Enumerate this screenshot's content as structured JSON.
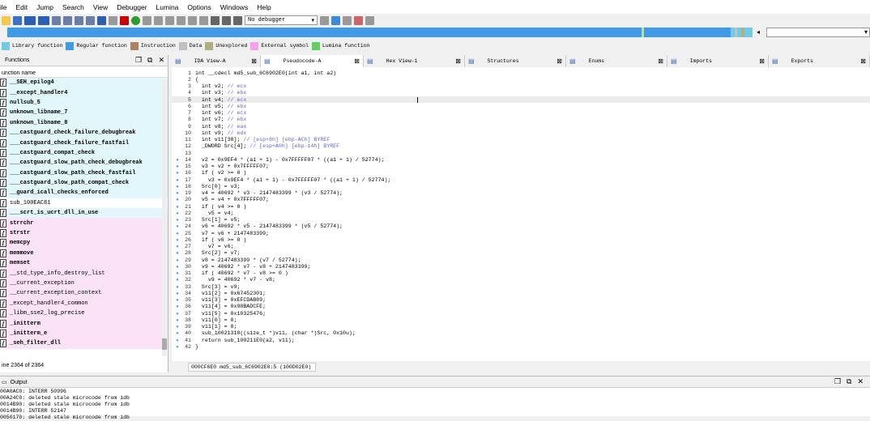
{
  "menubar": [
    "ile",
    "Edit",
    "Jump",
    "Search",
    "View",
    "Debugger",
    "Lumina",
    "Options",
    "Windows",
    "Help"
  ],
  "toolbar": {
    "debugger_label": "No debugger"
  },
  "legend": [
    {
      "label": "Library function",
      "color": "#70cbe6"
    },
    {
      "label": "Regular function",
      "color": "#3f9be6"
    },
    {
      "label": "Instruction",
      "color": "#b08060"
    },
    {
      "label": "Data",
      "color": "#c0c0c0"
    },
    {
      "label": "Unexplored",
      "color": "#b0ae7e"
    },
    {
      "label": "External symbol",
      "color": "#f7a0f0"
    },
    {
      "label": "Lumina function",
      "color": "#60d060"
    }
  ],
  "functions": {
    "title": "Functions",
    "column": "unction name",
    "status": "ine 2364 of 2364",
    "items": [
      {
        "name": "__SEH_epilog4",
        "style": "lib"
      },
      {
        "name": "__except_handler4",
        "style": "lib"
      },
      {
        "name": "nullsub_5",
        "style": "lib"
      },
      {
        "name": "unknown_libname_7",
        "style": "lib"
      },
      {
        "name": "unknown_libname_8",
        "style": "lib"
      },
      {
        "name": "___castguard_check_failure_debugbreak",
        "style": "lib"
      },
      {
        "name": "___castguard_check_failure_fastfail",
        "style": "lib"
      },
      {
        "name": "___castguard_compat_check",
        "style": "lib"
      },
      {
        "name": "___castguard_slow_path_check_debugbreak",
        "style": "lib"
      },
      {
        "name": "___castguard_slow_path_check_fastfail",
        "style": "lib"
      },
      {
        "name": "___castguard_slow_path_compat_check",
        "style": "lib"
      },
      {
        "name": "__guard_icall_checks_enforced",
        "style": "libb"
      },
      {
        "name": "sub_100EAC81",
        "style": "reg"
      },
      {
        "name": "___scrt_is_ucrt_dll_in_use",
        "style": "lib"
      },
      {
        "name": "strrchr",
        "style": "extb"
      },
      {
        "name": "strstr",
        "style": "extb"
      },
      {
        "name": "memcpy",
        "style": "extb"
      },
      {
        "name": "memmove",
        "style": "extb"
      },
      {
        "name": "memset",
        "style": "extb"
      },
      {
        "name": "__std_type_info_destroy_list",
        "style": "ext"
      },
      {
        "name": "__current_exception",
        "style": "ext"
      },
      {
        "name": "__current_exception_context",
        "style": "ext"
      },
      {
        "name": "_except_handler4_common",
        "style": "ext"
      },
      {
        "name": "_libm_sse2_log_precise",
        "style": "ext"
      },
      {
        "name": "_initterm",
        "style": "extb"
      },
      {
        "name": "_initterm_e",
        "style": "extb"
      },
      {
        "name": "_seh_filter_dll",
        "style": "extb"
      }
    ]
  },
  "tabs": [
    {
      "label": "IDA View-A",
      "width": 110
    },
    {
      "label": "Pseudocode-A",
      "width": 127,
      "active": true
    },
    {
      "label": "Hex View-1",
      "width": 125
    },
    {
      "label": "Structures",
      "width": 125
    },
    {
      "label": "Enums",
      "width": 125
    },
    {
      "label": "Imports",
      "width": 125
    },
    {
      "label": "Exports",
      "width": 125
    }
  ],
  "code": [
    {
      "n": "1",
      "t": "int __cdecl md5_sub_6C6902E0(int a1, int a2)",
      "c": ""
    },
    {
      "n": "2",
      "t": "{",
      "c": ""
    },
    {
      "n": "3",
      "t": "  int v2; ",
      "c": "// ecx"
    },
    {
      "n": "4",
      "t": "  int v3; ",
      "c": "// ebx"
    },
    {
      "n": "5",
      "t": "  int v4; ",
      "c": "// ecx"
    },
    {
      "n": "6",
      "t": "  int v5; ",
      "c": "// ebx"
    },
    {
      "n": "7",
      "t": "  int v6; ",
      "c": "// ecx"
    },
    {
      "n": "8",
      "t": "  int v7; ",
      "c": "// ebx"
    },
    {
      "n": "9",
      "t": "  int v8; ",
      "c": "// eax"
    },
    {
      "n": "10",
      "t": "  int v9; ",
      "c": "// edx"
    },
    {
      "n": "11",
      "t": "  int v11[38]; ",
      "c": "// [esp+8h] [ebp-ACh] BYREF"
    },
    {
      "n": "12",
      "t": "  _DWORD Src[4]; ",
      "c": "// [esp+A0h] [ebp-14h] BYREF"
    },
    {
      "n": "13",
      "t": "",
      "c": ""
    },
    {
      "n": "14",
      "t": "  v2 = 0x9EF4 * (a1 + 1) - 0x7FFFFF07 * ((a1 + 1) / 52774);",
      "c": "",
      "d": 1
    },
    {
      "n": "15",
      "t": "  v3 = v2 + 0x7FFFFF07;",
      "c": "",
      "d": 1
    },
    {
      "n": "16",
      "t": "  if ( v2 >= 0 )",
      "c": "",
      "d": 1
    },
    {
      "n": "17",
      "t": "    v3 = 0x9EF4 * (a1 + 1) - 0x7FFFFF07 * ((a1 + 1) / 52774);",
      "c": "",
      "d": 1
    },
    {
      "n": "18",
      "t": "  Src[0] = v3;",
      "c": "",
      "d": 1
    },
    {
      "n": "19",
      "t": "  v4 = 40692 * v3 - 2147483399 * (v3 / 52774);",
      "c": "",
      "d": 1
    },
    {
      "n": "20",
      "t": "  v5 = v4 + 0x7FFFFF07;",
      "c": "",
      "d": 1
    },
    {
      "n": "21",
      "t": "  if ( v4 >= 0 )",
      "c": "",
      "d": 1
    },
    {
      "n": "22",
      "t": "    v5 = v4;",
      "c": "",
      "d": 1
    },
    {
      "n": "23",
      "t": "  Src[1] = v5;",
      "c": "",
      "d": 1
    },
    {
      "n": "24",
      "t": "  v6 = 40692 * v5 - 2147483399 * (v5 / 52774);",
      "c": "",
      "d": 1
    },
    {
      "n": "25",
      "t": "  v7 = v6 + 2147483399;",
      "c": "",
      "d": 1
    },
    {
      "n": "26",
      "t": "  if ( v6 >= 0 )",
      "c": "",
      "d": 1
    },
    {
      "n": "27",
      "t": "    v7 = v6;",
      "c": "",
      "d": 1
    },
    {
      "n": "28",
      "t": "  Src[2] = v7;",
      "c": "",
      "d": 1
    },
    {
      "n": "29",
      "t": "  v8 = 2147483399 * (v7 / 52774);",
      "c": "",
      "d": 1
    },
    {
      "n": "30",
      "t": "  v9 = 40692 * v7 - v8 + 2147483399;",
      "c": "",
      "d": 1
    },
    {
      "n": "31",
      "t": "  if ( 40692 * v7 - v8 >= 0 )",
      "c": "",
      "d": 1
    },
    {
      "n": "32",
      "t": "    v9 = 40692 * v7 - v8;",
      "c": "",
      "d": 1
    },
    {
      "n": "33",
      "t": "  Src[3] = v9;",
      "c": "",
      "d": 1
    },
    {
      "n": "34",
      "t": "  v11[2] = 0x67452301;",
      "c": "",
      "d": 1
    },
    {
      "n": "35",
      "t": "  v11[3] = 0xEFCDAB89;",
      "c": "",
      "d": 1
    },
    {
      "n": "36",
      "t": "  v11[4] = 0x98BADCFE;",
      "c": "",
      "d": 1
    },
    {
      "n": "37",
      "t": "  v11[5] = 0x10325476;",
      "c": "",
      "d": 1
    },
    {
      "n": "38",
      "t": "  v11[0] = 0;",
      "c": "",
      "d": 1
    },
    {
      "n": "39",
      "t": "  v11[1] = 0;",
      "c": "",
      "d": 1
    },
    {
      "n": "40",
      "t": "  sub_10021310((size_t *)v11, (char *)Src, 0x10u);",
      "c": "",
      "d": 1
    },
    {
      "n": "41",
      "t": "  return sub_100211E0(a2, v11);",
      "c": "",
      "d": 1
    },
    {
      "n": "42",
      "t": "}",
      "c": "",
      "d": 1
    }
  ],
  "code_status": "000CF6E0 md5_sub_6C6902E0:5 (100D02E0)",
  "output": {
    "title": "Output",
    "lines": [
      "00A0AC0: INTERR 50996",
      "00A24C0: deleted stale microcode from idb",
      "0014B90: deleted stale microcode from idb",
      "0014B90: INTERR 52147",
      "0050170: deleted stale microcode from idb"
    ]
  }
}
